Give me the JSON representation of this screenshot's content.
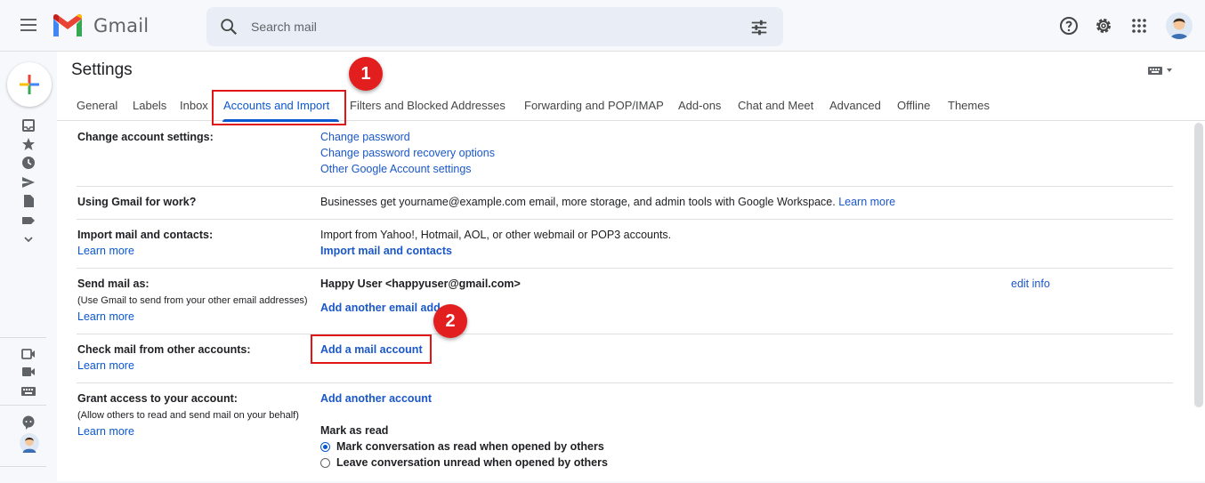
{
  "app": {
    "title": "Gmail",
    "colors": {
      "brand_blue": "#0b57d0",
      "highlight_red": "#e01515",
      "badge_red": "#e31e1e"
    }
  },
  "search": {
    "placeholder": "Search mail"
  },
  "page": {
    "title": "Settings"
  },
  "tabs": [
    {
      "label": "General"
    },
    {
      "label": "Labels"
    },
    {
      "label": "Inbox"
    },
    {
      "label": "Accounts and Import",
      "active": true
    },
    {
      "label": "Filters and Blocked Addresses"
    },
    {
      "label": "Forwarding and POP/IMAP"
    },
    {
      "label": "Add-ons"
    },
    {
      "label": "Chat and Meet"
    },
    {
      "label": "Advanced"
    },
    {
      "label": "Offline"
    },
    {
      "label": "Themes"
    }
  ],
  "rows": {
    "change_account": {
      "label": "Change account settings:",
      "links": [
        "Change password",
        "Change password recovery options",
        "Other Google Account settings"
      ]
    },
    "work": {
      "label": "Using Gmail for work?",
      "text": "Businesses get yourname@example.com email, more storage, and admin tools with Google Workspace.",
      "learn": "Learn more"
    },
    "import": {
      "label": "Import mail and contacts:",
      "learn": "Learn more",
      "text": "Import from Yahoo!, Hotmail, AOL, or other webmail or POP3 accounts.",
      "action": "Import mail and contacts"
    },
    "send_as": {
      "label": "Send mail as:",
      "sublabel": "(Use Gmail to send from your other email addresses)",
      "learn": "Learn more",
      "identity": "Happy User <happyuser@gmail.com>",
      "edit": "edit info",
      "action": "Add another email add"
    },
    "check_mail": {
      "label": "Check mail from other accounts:",
      "learn": "Learn more",
      "action": "Add a mail account"
    },
    "grant": {
      "label": "Grant access to your account:",
      "sublabel": "(Allow others to read and send mail on your behalf)",
      "learn": "Learn more",
      "action": "Add another account",
      "mark_title": "Mark as read",
      "options": [
        {
          "label": "Mark conversation as read when opened by others",
          "checked": true
        },
        {
          "label": "Leave conversation unread when opened by others",
          "checked": false
        }
      ]
    }
  },
  "annotations": {
    "step1": "1",
    "step2": "2"
  },
  "icons": {
    "menu": "menu-icon",
    "search": "search-icon",
    "tune": "tune-icon",
    "help": "help-icon",
    "settings": "gear-icon",
    "apps": "apps-icon",
    "compose": "compose-plus-icon",
    "keyboard": "keyboard-icon"
  }
}
